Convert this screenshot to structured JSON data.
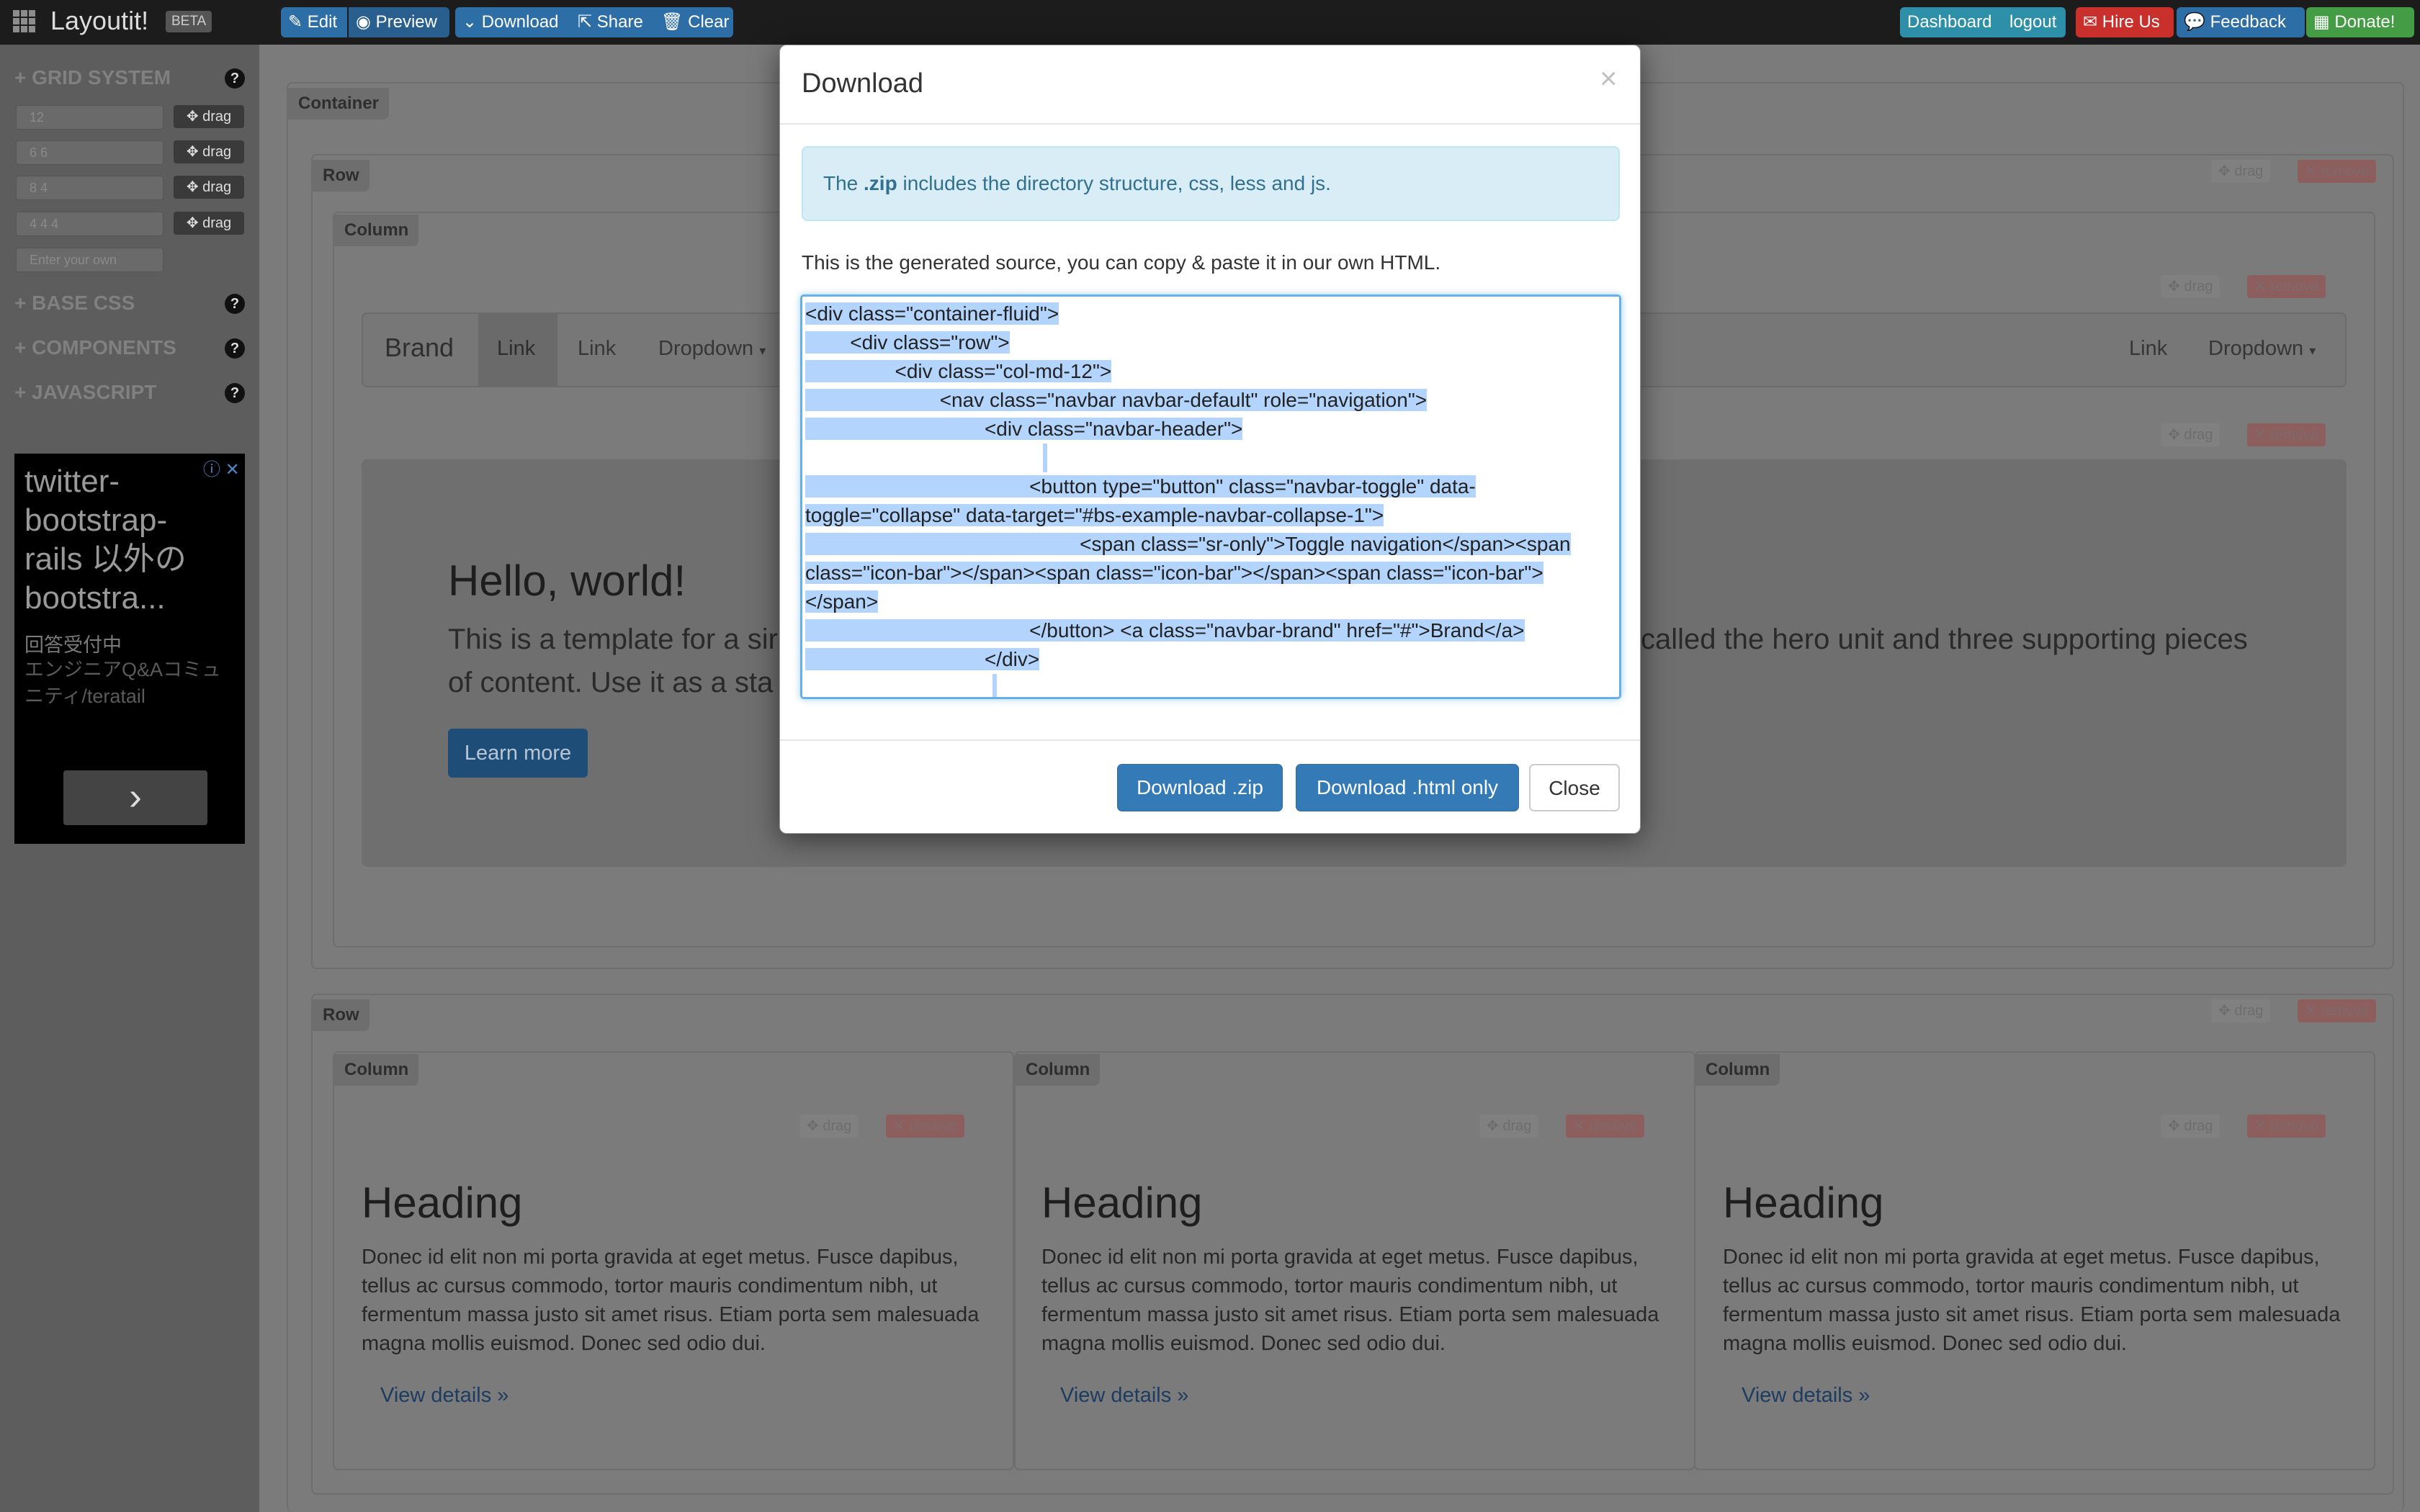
{
  "topbar": {
    "app_title": "Layoutit!",
    "beta_badge": "BETA",
    "nav_buttons": [
      "Edit",
      "Preview",
      "Download",
      "Share",
      "Clear"
    ],
    "right_buttons": {
      "dashboard": "Dashboard",
      "logout": "logout",
      "hire_us": "Hire Us",
      "feedback": "Feedback",
      "donate": "Donate!"
    }
  },
  "sidebar": {
    "sections": [
      "GRID SYSTEM",
      "BASE CSS",
      "COMPONENTS",
      "JAVASCRIPT"
    ],
    "help_glyph": "?",
    "grid_presets": [
      "12",
      "6 6",
      "8 4",
      "4 4 4"
    ],
    "custom_placeholder": "Enter your own",
    "drag_label": "drag",
    "ad": {
      "title": "twitter-bootstrap-rails 以外のbootstra...",
      "line1": "回答受付中",
      "line2": "エンジニアQ&Aコミュニティ/teratail",
      "arrow": "›"
    }
  },
  "canvas": {
    "container_label": "Container",
    "row_label": "Row",
    "column_label": "Column",
    "drag_label": "drag",
    "remove_label": "remove",
    "navbar": {
      "brand": "Brand",
      "link1": "Link",
      "link2": "Link",
      "dropdown": "Dropdown",
      "right_link": "Link",
      "right_dropdown": "Dropdown"
    },
    "hero": {
      "title": "Hello, world!",
      "text_left_line1": "This is a template for a sir",
      "text_left_line2": "of content. Use it as a sta",
      "text_right": "called the hero unit and three supporting pieces",
      "button": "Learn more"
    },
    "columns": [
      {
        "heading": "Heading",
        "text": "Donec id elit non mi porta gravida at eget metus. Fusce dapibus, tellus ac cursus commodo, tortor mauris condimentum nibh, ut fermentum massa justo sit amet risus. Etiam porta sem malesuada magna mollis euismod. Donec sed odio dui.",
        "link": "View details »"
      },
      {
        "heading": "Heading",
        "text": "Donec id elit non mi porta gravida at eget metus. Fusce dapibus, tellus ac cursus commodo, tortor mauris condimentum nibh, ut fermentum massa justo sit amet risus. Etiam porta sem malesuada magna mollis euismod. Donec sed odio dui.",
        "link": "View details »"
      },
      {
        "heading": "Heading",
        "text": "Donec id elit non mi porta gravida at eget metus. Fusce dapibus, tellus ac cursus commodo, tortor mauris condimentum nibh, ut fermentum massa justo sit amet risus. Etiam porta sem malesuada magna mollis euismod. Donec sed odio dui.",
        "link": "View details »"
      }
    ]
  },
  "modal": {
    "title": "Download",
    "close_glyph": "×",
    "info_prefix": "The",
    "info_bold": ".zip",
    "info_suffix": "includes the directory structure, css, less and js.",
    "description": "This is the generated source, you can copy & paste it in our own HTML.",
    "code_lines": [
      "<div class=\"container-fluid\">",
      "\t<div class=\"row\">",
      "\t\t<div class=\"col-md-12\">",
      "\t\t\t<nav class=\"navbar navbar-default\" role=\"navigation\">",
      "\t\t\t\t<div class=\"navbar-header\">",
      "",
      "\t\t\t\t\t<button type=\"button\" class=\"navbar-toggle\" data-",
      "toggle=\"collapse\" data-target=\"#bs-example-navbar-collapse-1\">",
      "\t\t\t\t\t\t <span class=\"sr-only\">Toggle navigation</span><span",
      "class=\"icon-bar\"></span><span class=\"icon-bar\"></span><span class=\"icon-bar\">",
      "</span>",
      "\t\t\t\t\t</button> <a class=\"navbar-brand\" href=\"#\">Brand</a>",
      "\t\t\t\t</div>",
      ""
    ],
    "buttons": {
      "download_zip": "Download .zip",
      "download_html": "Download .html only",
      "close": "Close"
    }
  },
  "colors": {
    "primary": "#337ab7",
    "topbar": "#1c1c1c",
    "selection": "#b3d4fc",
    "info_bg": "#d9edf7"
  }
}
